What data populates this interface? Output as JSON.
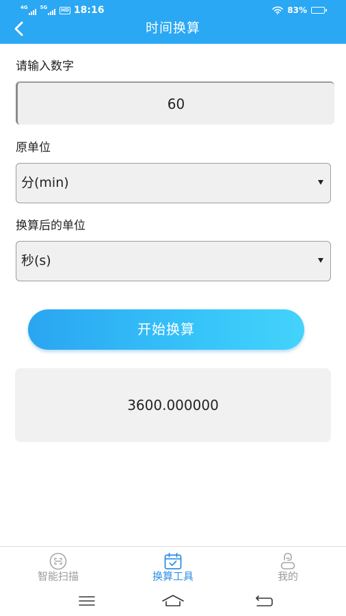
{
  "status_bar": {
    "network_1": "4G",
    "network_2": "5G",
    "hd_badge": "HD",
    "time": "18:16",
    "battery_pct": "83%",
    "battery_level": 0.83
  },
  "header": {
    "title": "时间换算"
  },
  "form": {
    "number_label": "请输入数字",
    "number_value": "60",
    "source_unit_label": "原单位",
    "source_unit_value": "分(min)",
    "target_unit_label": "换算后的单位",
    "target_unit_value": "秒(s)",
    "convert_label": "开始换算"
  },
  "result": {
    "value": "3600.000000"
  },
  "bottom_nav": {
    "tabs": [
      {
        "label": "智能扫描",
        "icon": "smart-scan-icon",
        "active": false
      },
      {
        "label": "换算工具",
        "icon": "calendar-check-icon",
        "active": true
      },
      {
        "label": "我的",
        "icon": "profile-icon",
        "active": false
      }
    ]
  },
  "colors": {
    "primary": "#2aa8f4",
    "active_tab": "#2b8fe6",
    "inactive_tab": "#9a9a9a"
  }
}
